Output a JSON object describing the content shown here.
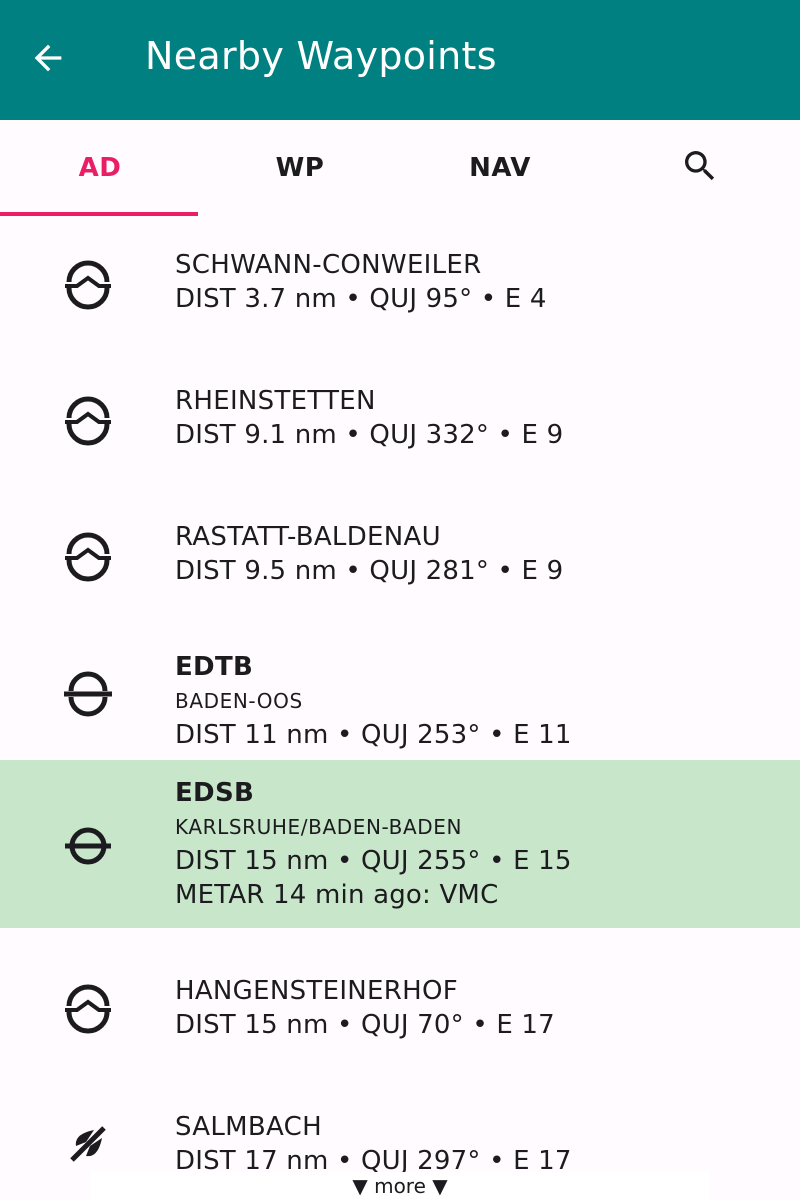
{
  "appbar": {
    "title": "Nearby Waypoints",
    "back_icon": "arrow-back-icon",
    "color": "#008080"
  },
  "tabs": {
    "items": [
      {
        "label": "AD",
        "active": true
      },
      {
        "label": "WP",
        "active": false
      },
      {
        "label": "NAV",
        "active": false
      }
    ],
    "search_icon": "search-icon",
    "accent": "#e91e63"
  },
  "list": {
    "selected_color": "#c8e6c9",
    "items": [
      {
        "icon": "glider-airfield-icon",
        "name": "SCHWANN-CONWEILER",
        "details": "DIST 3.7 nm • QUJ 95° • E 4"
      },
      {
        "icon": "glider-airfield-icon",
        "name": "RHEINSTETTEN",
        "details": "DIST 9.1 nm • QUJ 332° • E 9"
      },
      {
        "icon": "glider-airfield-icon",
        "name": "RASTATT-BALDENAU",
        "details": "DIST 9.5 nm • QUJ 281° • E 9"
      },
      {
        "icon": "airfield-icon",
        "code": "EDTB",
        "name": "BADEN-OOS",
        "details": "DIST 11 nm • QUJ 253° • E 11"
      },
      {
        "icon": "airport-icon",
        "code": "EDSB",
        "name": "KARLSRUHE/BADEN-BADEN",
        "details": "DIST 15 nm • QUJ 255° • E 15",
        "metar": "METAR 14 min ago: VMC"
      },
      {
        "icon": "glider-airfield-icon",
        "name": "HANGENSTEINERHOF",
        "details": "DIST 15 nm • QUJ 70° • E 17"
      },
      {
        "icon": "ultralight-field-icon",
        "name": "SALMBACH",
        "details": "DIST 17 nm • QUJ 297° • E 17"
      }
    ]
  },
  "more_label": "▼ more ▼"
}
